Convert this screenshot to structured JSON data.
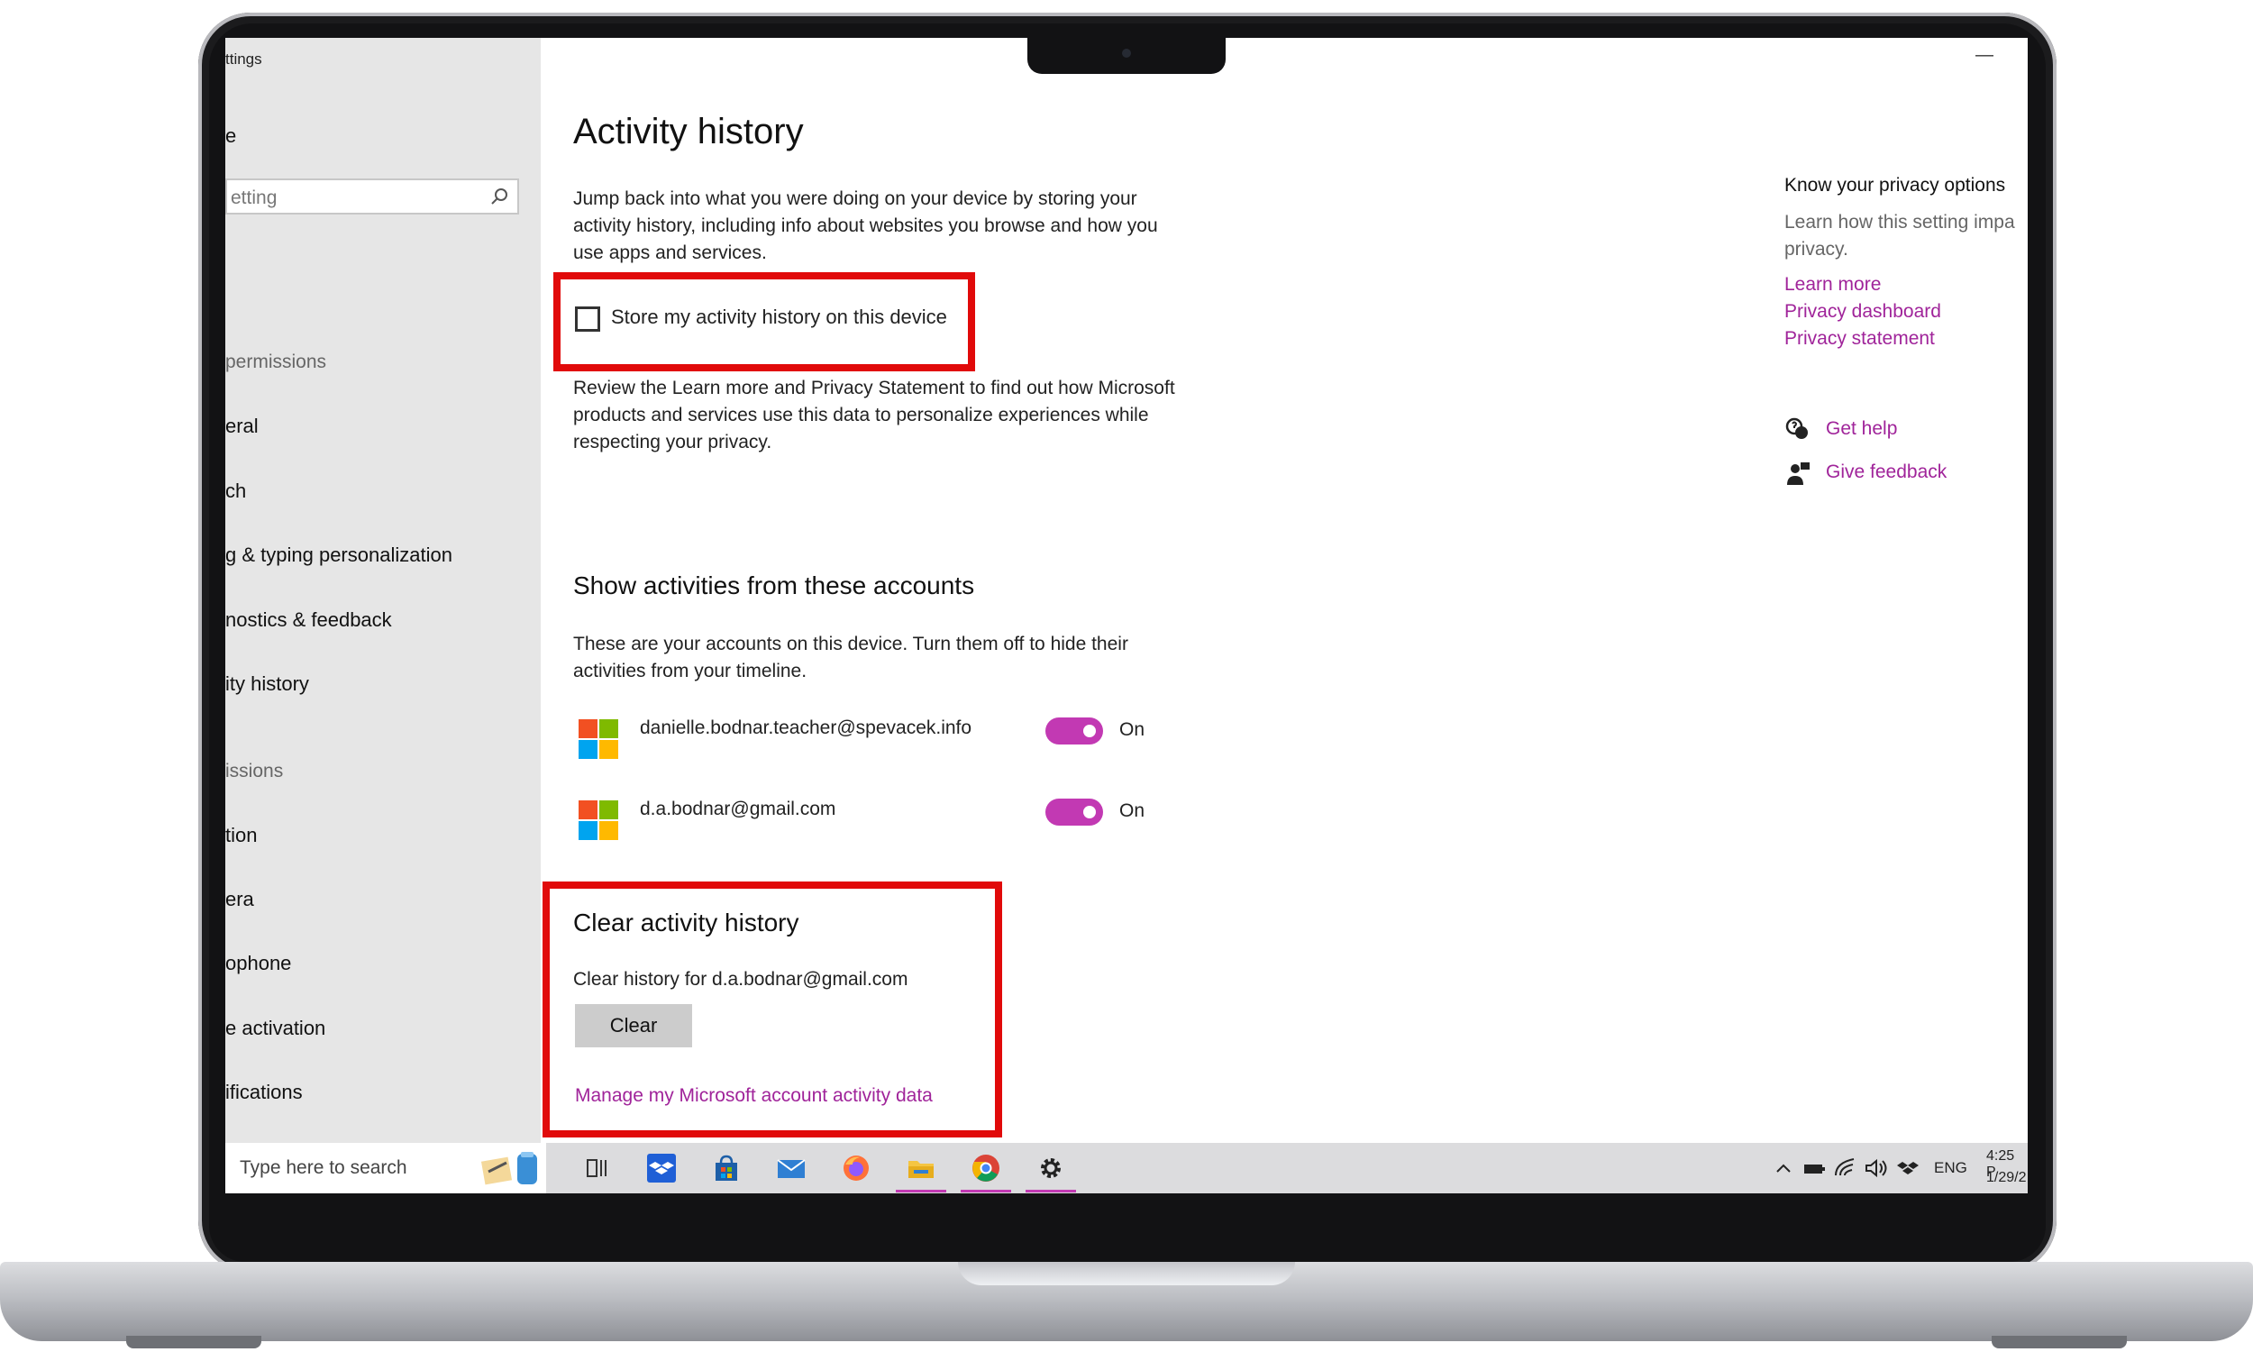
{
  "window": {
    "title": "ttings",
    "minimize_glyph": "—"
  },
  "sidebar": {
    "home_label": "e",
    "search": {
      "placeholder": "etting"
    },
    "sections": [
      {
        "kind": "heading",
        "label": "permissions"
      },
      {
        "kind": "item",
        "label": "eral"
      },
      {
        "kind": "item",
        "label": "ch"
      },
      {
        "kind": "item",
        "label": "g & typing personalization"
      },
      {
        "kind": "item",
        "label": "nostics & feedback"
      },
      {
        "kind": "item",
        "label": "ity history"
      },
      {
        "kind": "heading",
        "label": "issions"
      },
      {
        "kind": "item",
        "label": "tion"
      },
      {
        "kind": "item",
        "label": "era"
      },
      {
        "kind": "item",
        "label": "ophone"
      },
      {
        "kind": "item",
        "label": "e activation"
      },
      {
        "kind": "item",
        "label": "ifications"
      }
    ]
  },
  "main": {
    "title": "Activity history",
    "intro": "Jump back into what you were doing on your device by storing your activity history, including info about websites you browse and how you use apps and services.",
    "store_checkbox": {
      "label": "Store my activity history on this device",
      "checked": false
    },
    "review_text": "Review the Learn more and Privacy Statement to find out how Microsoft products and services use this data to personalize experiences while respecting your privacy.",
    "accounts_section": {
      "title": "Show activities from these accounts",
      "description": "These are your accounts on this device. Turn them off to hide their activities from your timeline.",
      "accounts": [
        {
          "email": "danielle.bodnar.teacher@spevacek.info",
          "toggle_state": "On",
          "enabled": true
        },
        {
          "email": "d.a.bodnar@gmail.com",
          "toggle_state": "On",
          "enabled": true
        }
      ]
    },
    "clear_section": {
      "title": "Clear activity history",
      "subtitle": "Clear history for d.a.bodnar@gmail.com",
      "button_label": "Clear",
      "manage_link": "Manage my Microsoft account activity data"
    }
  },
  "right_panel": {
    "title": "Know your privacy options",
    "description": "Learn how this setting impa privacy.",
    "links": [
      "Learn more",
      "Privacy dashboard",
      "Privacy statement"
    ],
    "help": {
      "get_help": "Get help",
      "give_feedback": "Give feedback"
    }
  },
  "taskbar": {
    "search_placeholder": "Type here to search",
    "tray": {
      "language": "ENG",
      "time": "4:25 P",
      "date": "1/29/2"
    }
  },
  "colors": {
    "accent": "#c239b3",
    "highlight": "#e10a0a",
    "link": "#a0249a"
  }
}
